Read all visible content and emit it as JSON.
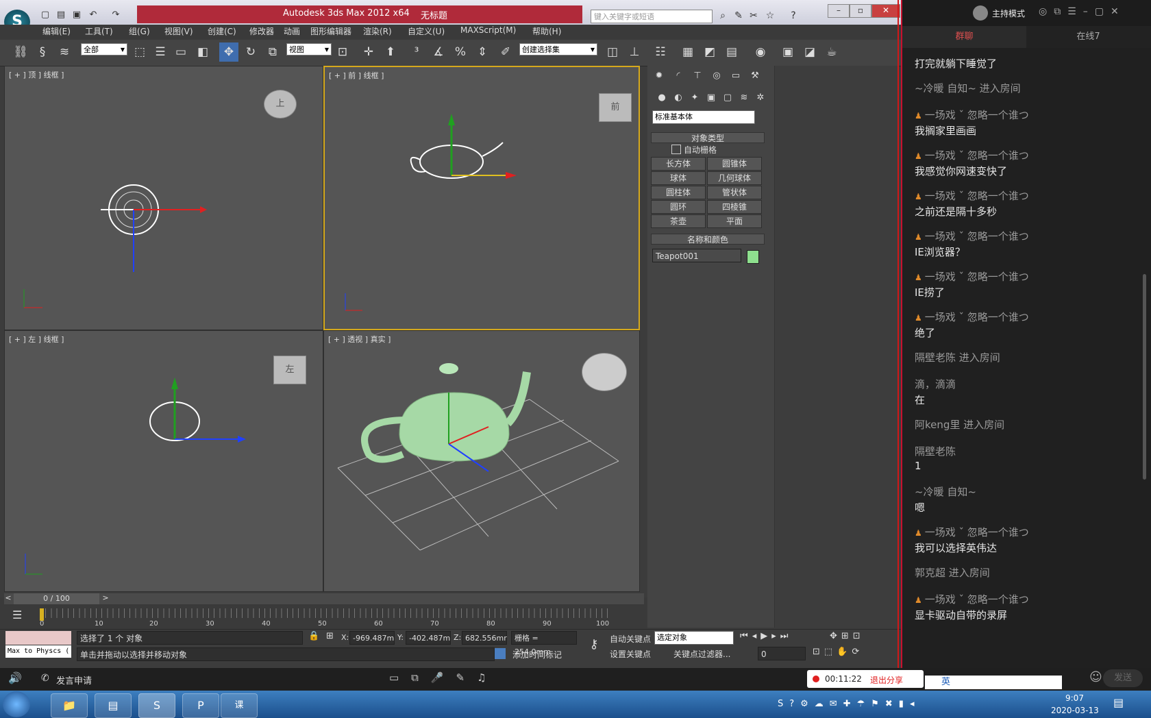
{
  "window": {
    "app_title": "Autodesk 3ds Max  2012 x64",
    "doc_title": "无标题",
    "search_placeholder": "键入关键字或短语",
    "logo_letter": "S"
  },
  "menu": [
    "编辑(E)",
    "工具(T)",
    "组(G)",
    "视图(V)",
    "创建(C)",
    "修改器",
    "动画",
    "图形编辑器",
    "渲染(R)",
    "自定义(U)",
    "MAXScript(M)",
    "帮助(H)"
  ],
  "toolbar": {
    "filter_value": "全部",
    "coord_value": "视图",
    "named_selection": "创建选择集"
  },
  "viewports": {
    "top": "[ + ] 顶 ] 线框 ]",
    "front": "[ + ] 前 ] 线框 ]",
    "left": "[ + ] 左 ] 线框 ]",
    "perspective": "[ + ] 透视 ] 真实 ]",
    "cube_top": "上",
    "cube_front": "前",
    "cube_left": "左"
  },
  "command_panel": {
    "category": "标准基本体",
    "object_type_header": "对象类型",
    "auto_grid": "自动栅格",
    "buttons": [
      "长方体",
      "圆锥体",
      "球体",
      "几何球体",
      "圆柱体",
      "管状体",
      "圆环",
      "四棱锥",
      "茶壶",
      "平面"
    ],
    "name_color_header": "名称和颜色",
    "object_name": "Teapot001",
    "object_color": "#8ee08e"
  },
  "timeline": {
    "frame_counter": "0 / 100",
    "ticks": [
      "0",
      "10",
      "20",
      "30",
      "40",
      "50",
      "60",
      "70",
      "80",
      "90",
      "100"
    ]
  },
  "status": {
    "maxscript_label": "Max to Physcs (",
    "selected": "选择了 1 个 对象",
    "prompt": "单击并拖动以选择并移动对象",
    "x_label": "X:",
    "x_value": "-969.487m",
    "y_label": "Y:",
    "y_value": "-402.487m",
    "z_label": "Z:",
    "z_value": "682.556mr",
    "grid": "栅格 = 254.0mm",
    "add_time_tag": "添加时间标记",
    "auto_key": "自动关键点",
    "set_key": "设置关键点",
    "key_mode": "选定对象",
    "key_filters": "关键点过滤器...",
    "frame_value": "0"
  },
  "chat": {
    "host_label": "主持模式",
    "tab_group": "群聊",
    "tab_online": "在线7",
    "items": [
      {
        "kind": "msg",
        "text": "打完就躺下睡觉了"
      },
      {
        "kind": "sys",
        "text": "~冷暖 自知~ 进入房间"
      },
      {
        "kind": "nick",
        "text": "一场戏 ˇ 忽略一个谁つ"
      },
      {
        "kind": "msg",
        "text": "我搁家里画画"
      },
      {
        "kind": "nick",
        "text": "一场戏 ˇ 忽略一个谁つ"
      },
      {
        "kind": "msg",
        "text": "我感觉你网速变快了"
      },
      {
        "kind": "nick",
        "text": "一场戏 ˇ 忽略一个谁つ"
      },
      {
        "kind": "msg",
        "text": "之前还是隔十多秒"
      },
      {
        "kind": "nick",
        "text": "一场戏 ˇ 忽略一个谁つ"
      },
      {
        "kind": "msg",
        "text": "IE浏览器？"
      },
      {
        "kind": "nick",
        "text": "一场戏 ˇ 忽略一个谁つ"
      },
      {
        "kind": "msg",
        "text": "IE捞了"
      },
      {
        "kind": "nick",
        "text": "一场戏 ˇ 忽略一个谁つ"
      },
      {
        "kind": "msg",
        "text": "绝了"
      },
      {
        "kind": "sys",
        "text": "隔壁老陈 进入房间"
      },
      {
        "kind": "sys",
        "text": "滴，滴滴"
      },
      {
        "kind": "msg",
        "text": "在"
      },
      {
        "kind": "sys",
        "text": "阿keng里 进入房间"
      },
      {
        "kind": "sys",
        "text": "隔壁老陈"
      },
      {
        "kind": "msg",
        "text": "1"
      },
      {
        "kind": "sys",
        "text": "~冷暖 自知~"
      },
      {
        "kind": "msg",
        "text": "嗯"
      },
      {
        "kind": "nick",
        "text": "一场戏 ˇ 忽略一个谁つ"
      },
      {
        "kind": "msg",
        "text": "我可以选择英伟达"
      },
      {
        "kind": "sys",
        "text": "郭克超 进入房间"
      },
      {
        "kind": "nick",
        "text": "一场戏 ˇ 忽略一个谁つ"
      },
      {
        "kind": "msg",
        "text": "显卡驱动自带的录屏"
      }
    ],
    "send_button": "发送"
  },
  "bottom_bar": {
    "apply_speak": "发言申请",
    "record_time": "00:11:22",
    "exit_share": "退出分享",
    "ime": "英"
  },
  "taskbar": {
    "time": "9:07",
    "date": "2020-03-13",
    "apps": [
      "文件资源管理器",
      "记事本",
      "3ds Max",
      "PowerPoint",
      "课"
    ]
  }
}
